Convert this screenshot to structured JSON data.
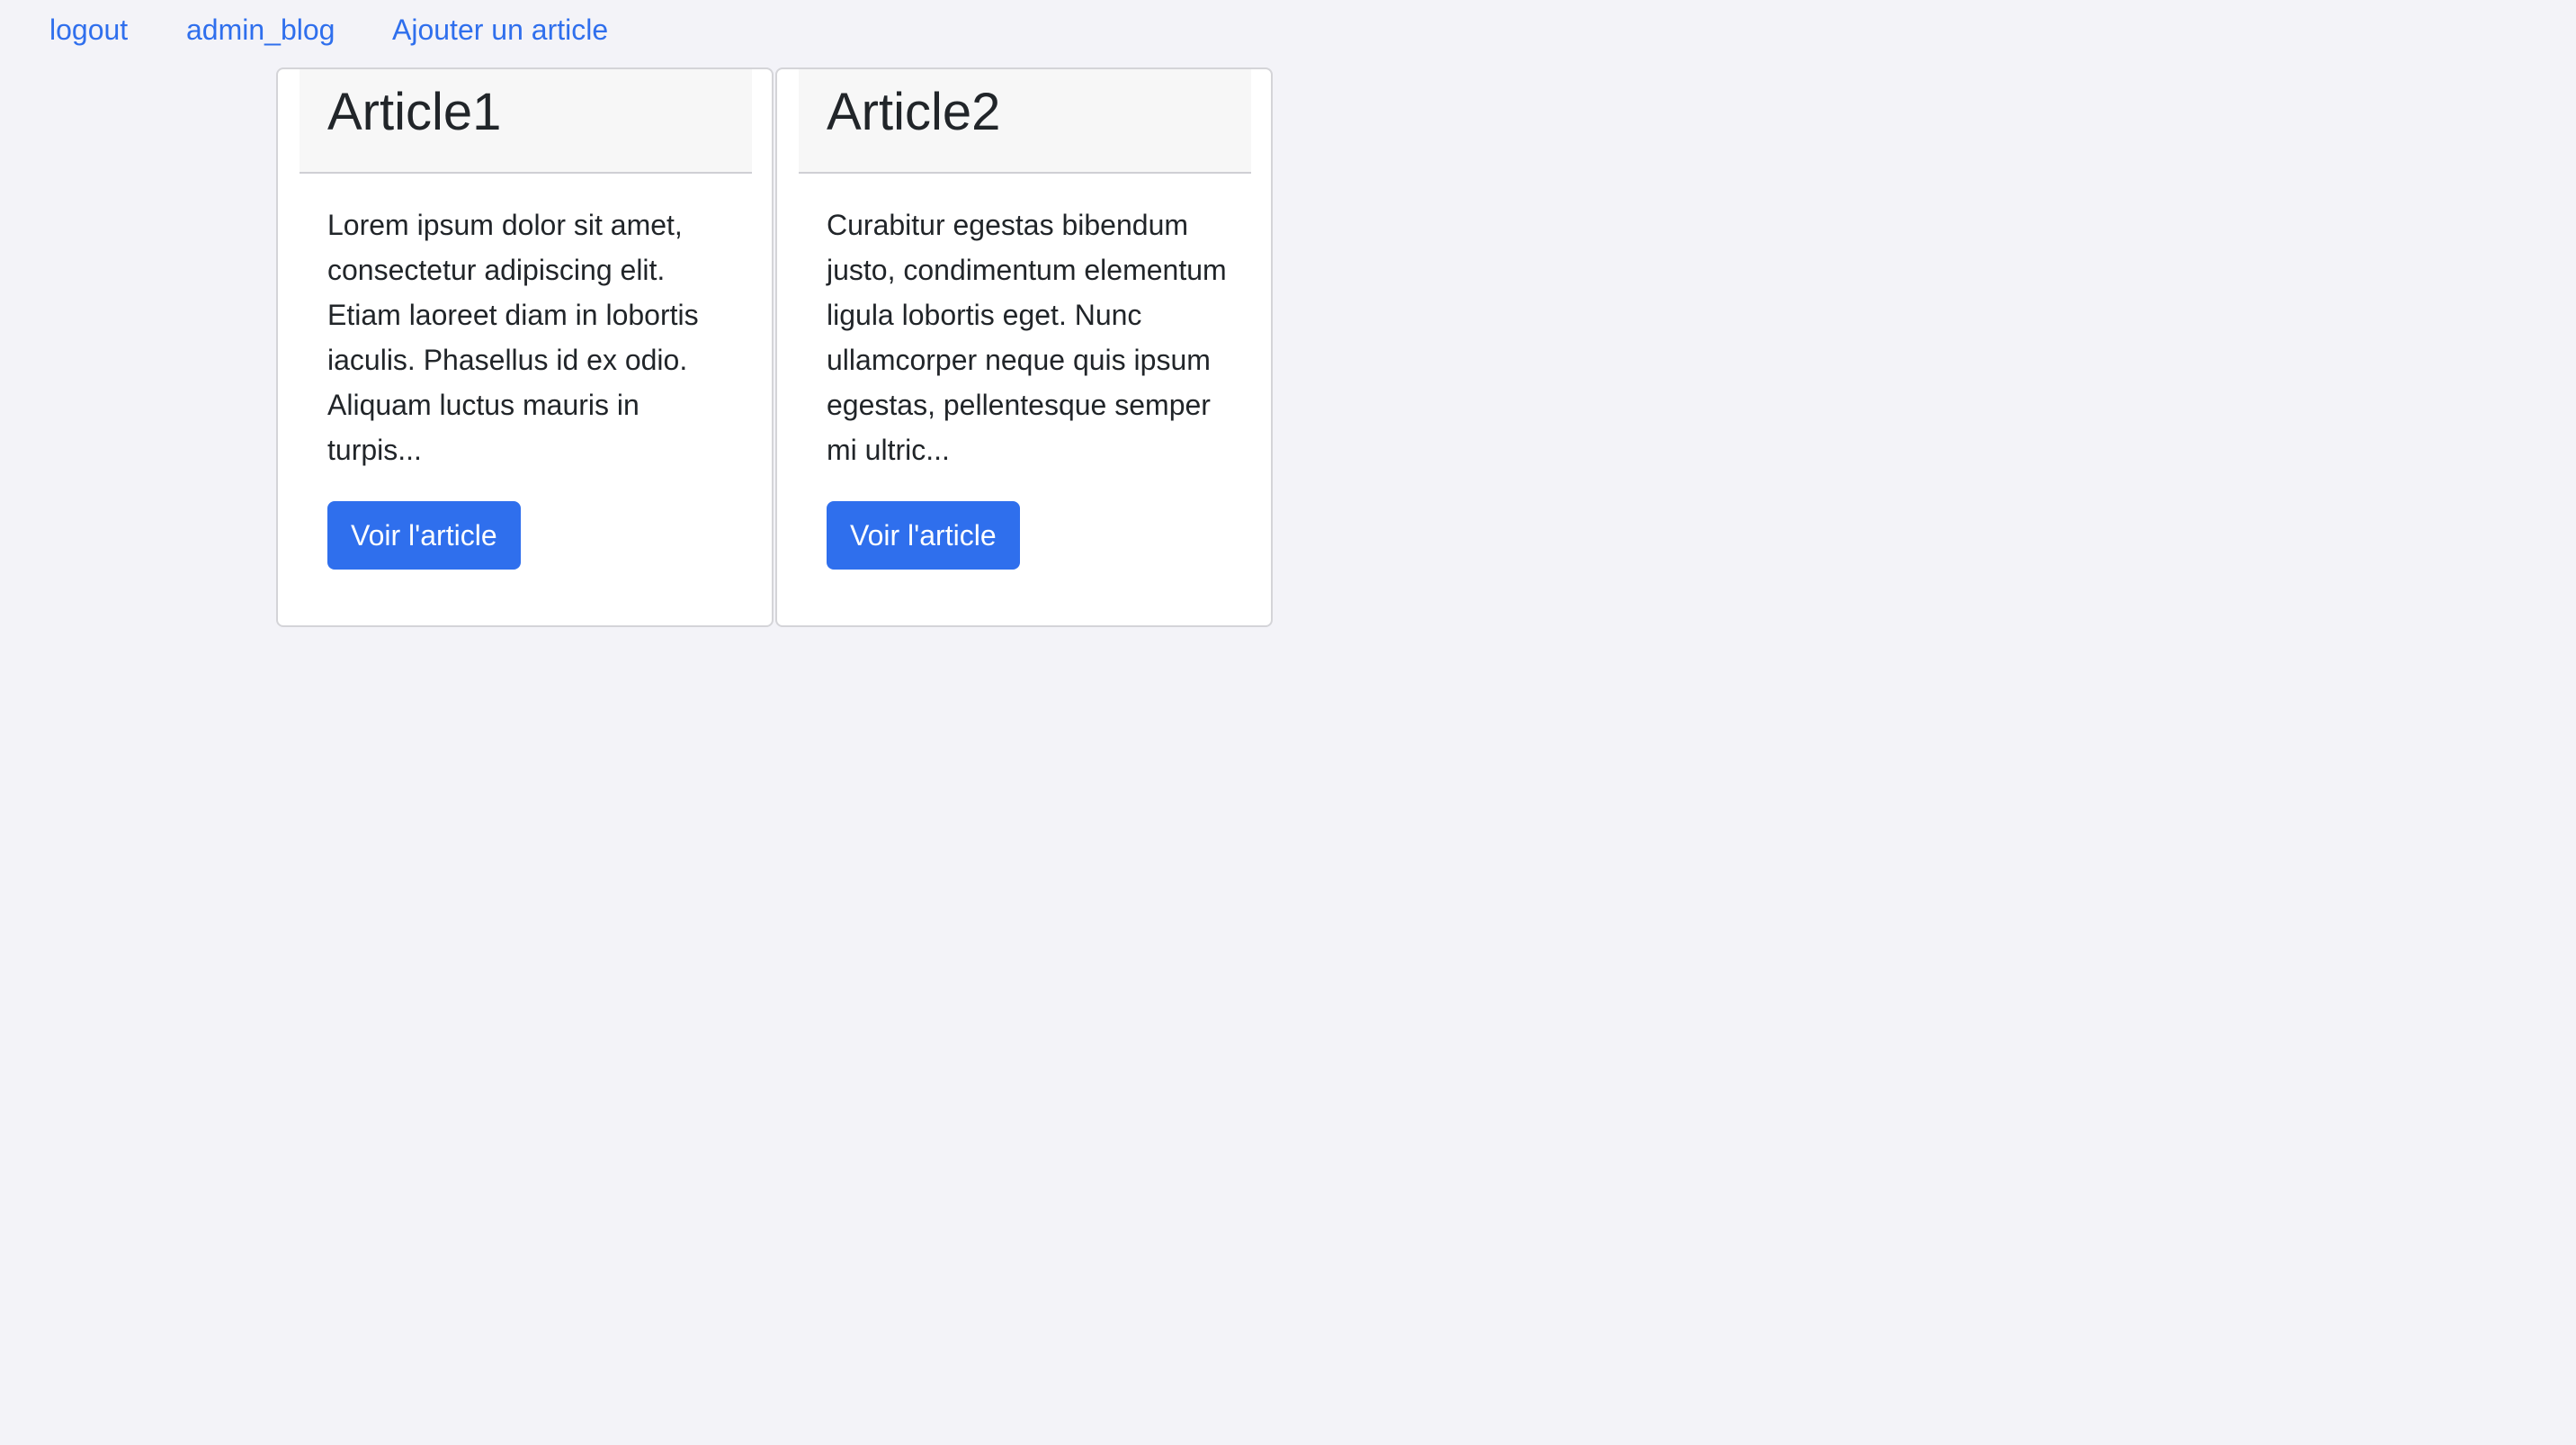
{
  "nav": {
    "links": [
      {
        "label": "logout"
      },
      {
        "label": "admin_blog"
      },
      {
        "label": "Ajouter un article"
      }
    ]
  },
  "articles": [
    {
      "title": "Article1",
      "excerpt": "Lorem ipsum dolor sit amet, consectetur adipiscing elit. Etiam laoreet diam in lobortis iaculis. Phasellus id ex odio. Aliquam luctus mauris in turpis...",
      "button_label": "Voir l'article"
    },
    {
      "title": "Article2",
      "excerpt": "Curabitur egestas bibendum justo, condimentum elementum ligula lobortis eget. Nunc ullamcorper neque quis ipsum egestas, pellentesque semper mi ultric...",
      "button_label": "Voir l'article"
    }
  ],
  "colors": {
    "link": "#2f6fed",
    "button_bg": "#2f6fed",
    "button_text": "#ffffff",
    "page_bg": "#f3f3f8"
  }
}
